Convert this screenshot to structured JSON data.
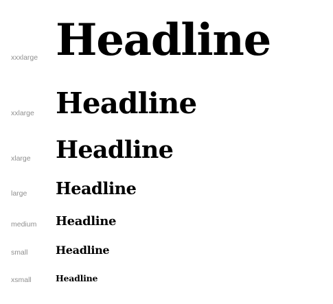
{
  "type_scale": {
    "rows": [
      {
        "size_name": "xxxlarge",
        "sample_text": "Headline"
      },
      {
        "size_name": "xxlarge",
        "sample_text": "Headline"
      },
      {
        "size_name": "xlarge",
        "sample_text": "Headline"
      },
      {
        "size_name": "large",
        "sample_text": "Headline"
      },
      {
        "size_name": "medium",
        "sample_text": "Headline"
      },
      {
        "size_name": "small",
        "sample_text": "Headline"
      },
      {
        "size_name": "xsmall",
        "sample_text": "Headline"
      }
    ]
  },
  "colors": {
    "background": "#ffffff",
    "label": "#8f8f8f",
    "headline": "#000000"
  }
}
